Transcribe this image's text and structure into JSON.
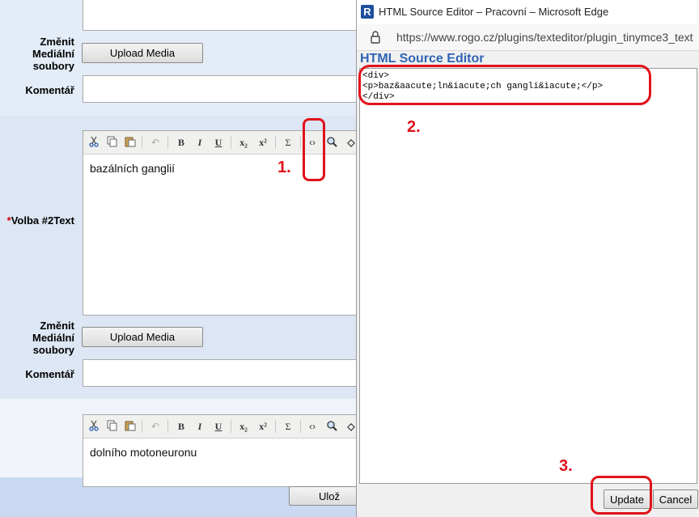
{
  "form": {
    "change_media_label_1": "Změnit\nMediální\nsoubory",
    "upload_media_1": "Upload Media",
    "comment_label_1": "Komentář",
    "required_star": "*",
    "option_label": "Volba #2Text",
    "editor1_content": "bazálních ganglií",
    "change_media_label_2": "Změnit\nMediální\nsoubory",
    "upload_media_2": "Upload Media",
    "comment_label_2": "Komentář",
    "editor2_content": "dolního motoneuronu",
    "save_button": "Ulož"
  },
  "toolbar": {
    "bold": "B",
    "italic": "I",
    "underline": "U",
    "subscript": "x₂",
    "superscript": "x²",
    "sigma": "Σ",
    "code": "‹›"
  },
  "annotations": {
    "step1": "1.",
    "step2": "2.",
    "step3": "3."
  },
  "popup": {
    "window_title": "HTML Source Editor – Pracovní – Microsoft Edge",
    "url": "https://www.rogo.cz/plugins/texteditor/plugin_tinymce3_text",
    "editor_heading": "HTML Source Editor",
    "source": "<div>\n<p>baz&aacute;ln&iacute;ch gangli&iacute;</p>\n</div>",
    "update_button": "Update",
    "cancel_button": "Cancel"
  },
  "colors": {
    "band": "#e4ecf7",
    "annotation": "#e0121b",
    "heading": "#2f64b4"
  }
}
